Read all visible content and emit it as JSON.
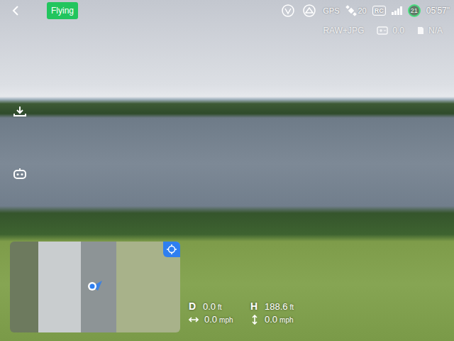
{
  "top_bar": {
    "status": "Flying",
    "gps": "GPS",
    "satellites": "20",
    "rc": "RC",
    "signal": {
      "level": 1
    },
    "battery": "21",
    "flight_time": "05'57\""
  },
  "camera_bar": {
    "format": "RAW+JPG",
    "exposure": "0.0",
    "storage": "N/A"
  },
  "telemetry": [
    {
      "kind": "letter",
      "label": "D",
      "value": "0.0",
      "unit": "ft"
    },
    {
      "kind": "letter",
      "label": "H",
      "value": "188.6",
      "unit": "ft"
    },
    {
      "kind": "hspeed",
      "label": "",
      "value": "0.0",
      "unit": "mph"
    },
    {
      "kind": "vspeed",
      "label": "",
      "value": "0.0",
      "unit": "mph"
    }
  ]
}
